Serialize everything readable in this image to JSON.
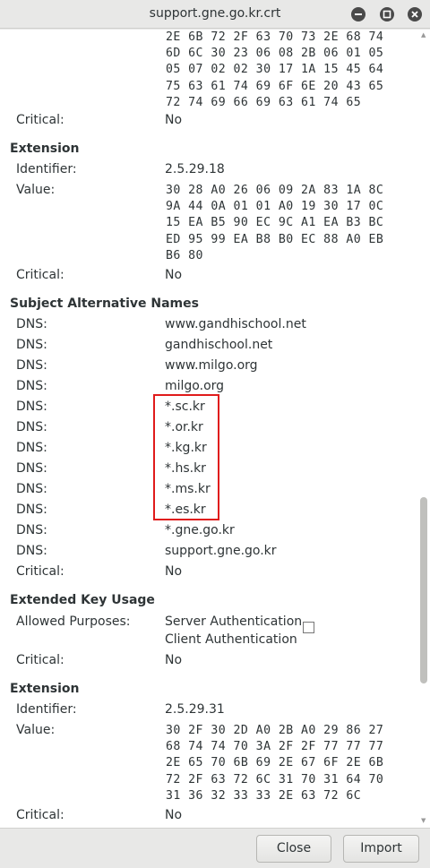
{
  "window": {
    "title": "support.gne.go.kr.crt"
  },
  "top_value_lines": [
    "2E 6B 72 2F 63 70 73 2E 68 74",
    "6D 6C 30 23 06 08 2B 06 01 05",
    "05 07 02 02 30 17 1A 15 45 64",
    "75 63 61 74 69 6F 6E 20 43 65",
    "72 74 69 66 69 63 61 74 65"
  ],
  "top_critical": {
    "label": "Critical:",
    "value": "No"
  },
  "ext1": {
    "heading": "Extension",
    "identifier_label": "Identifier:",
    "identifier": "2.5.29.18",
    "value_label": "Value:",
    "value_lines": [
      "30 28 A0 26 06 09 2A 83 1A 8C",
      "9A 44 0A 01 01 A0 19 30 17 0C",
      "15 EA B5 90 EC 9C A1 EA B3 BC",
      "ED 95 99 EA B8 B0 EC 88 A0 EB",
      "B6 80"
    ],
    "critical_label": "Critical:",
    "critical": "No"
  },
  "san": {
    "heading": "Subject Alternative Names",
    "dns_label": "DNS:",
    "entries": [
      "www.gandhischool.net",
      "gandhischool.net",
      "www.milgo.org",
      "milgo.org",
      "*.sc.kr",
      "*.or.kr",
      "*.kg.kr",
      "*.hs.kr",
      "*.ms.kr",
      "*.es.kr",
      "*.gne.go.kr",
      "support.gne.go.kr"
    ],
    "critical_label": "Critical:",
    "critical": "No"
  },
  "eku": {
    "heading": "Extended Key Usage",
    "purposes_label": "Allowed Purposes:",
    "purpose_1": "Server Authentication",
    "purpose_2": "Client Authentication",
    "critical_label": "Critical:",
    "critical": "No"
  },
  "ext2": {
    "heading": "Extension",
    "identifier_label": "Identifier:",
    "identifier": "2.5.29.31",
    "value_label": "Value:",
    "value_lines": [
      "30 2F 30 2D A0 2B A0 29 86 27",
      "68 74 74 70 3A 2F 2F 77 77 77",
      "2E 65 70 6B 69 2E 67 6F 2E 6B",
      "72 2F 63 72 6C 31 70 31 64 70",
      "31 36 32 33 33 2E 63 72 6C"
    ],
    "critical_label": "Critical:",
    "critical": "No"
  },
  "buttons": {
    "close": "Close",
    "import": "Import"
  },
  "colors": {
    "highlight": "#e01b1b",
    "window_bg": "#e8e8e7",
    "content_bg": "#ffffff"
  },
  "icons": [
    "minimize-icon",
    "maximize-icon",
    "close-icon"
  ]
}
